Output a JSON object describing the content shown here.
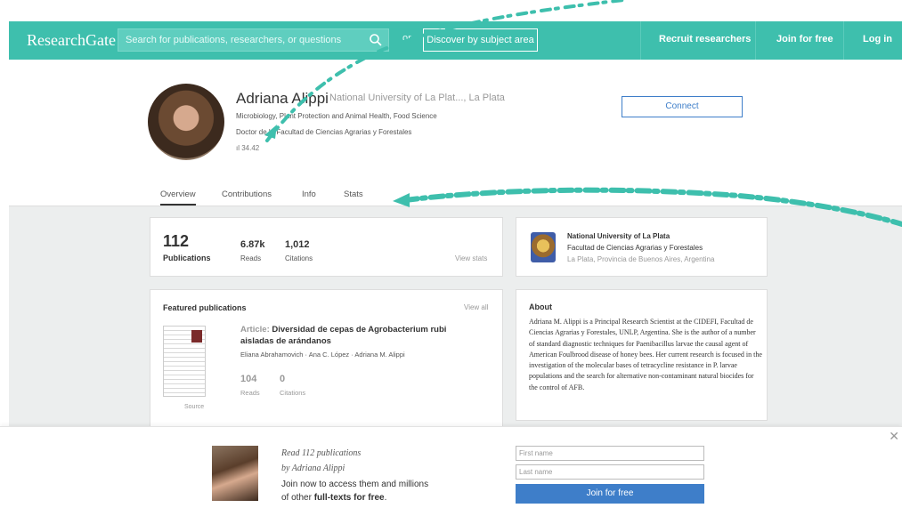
{
  "header": {
    "brand": "ResearchGate",
    "search_placeholder": "Search for publications, researchers, or questions",
    "or_text": "or",
    "discover_label": "Discover by subject area",
    "recruit_label": "Recruit researchers",
    "join_label": "Join for free",
    "login_label": "Log in"
  },
  "profile": {
    "name": "Adriana Alippi",
    "institution": "National University of La Plat..., La Plata",
    "disciplines": "Microbiology, Plant Protection and Animal Health, Food Science",
    "degree": "Doctor de la Facultad de Ciencias Agrarias y Forestales",
    "score": "34.42",
    "connect_label": "Connect"
  },
  "tabs": [
    {
      "label": "Overview"
    },
    {
      "label": "Contributions"
    },
    {
      "label": "Info"
    },
    {
      "label": "Stats"
    }
  ],
  "stats": {
    "publications_count": "112",
    "publications_label": "Publications",
    "reads_count": "6.87k",
    "reads_label": "Reads",
    "citations_count": "1,012",
    "citations_label": "Citations",
    "view_stats": "View stats"
  },
  "affiliation": {
    "university": "National University of La Plata",
    "faculty": "Facultad de Ciencias Agrarias y Forestales",
    "location": "La Plata, Provincia de Buenos Aires, Argentina"
  },
  "featured": {
    "title": "Featured publications",
    "view_all": "View all",
    "type": "Article:",
    "pub_title": "Diversidad de cepas de Agrobacterium rubi aisladas de arándanos",
    "authors": "Eliana Abrahamovich · Ana C. López · Adriana M. Alippi",
    "reads": "104",
    "reads_label": "Reads",
    "citations": "0",
    "citations_label": "Citations",
    "source": "Source"
  },
  "about": {
    "title": "About",
    "text": "Adriana M. Alippi is a Principal Research Scientist at the CIDEFI, Facultad de Ciencias Agrarias y Forestales, UNLP, Argentina. She is the author of a number of standard diagnostic techniques for Paenibacillus larvae the causal agent of American Foulbrood disease of honey bees. Her current research is focused in the investigation of the molecular bases of tetracycline resistance in P. larvae populations and the search for alternative non-contaminant natural biocides for the control of AFB."
  },
  "signup": {
    "line1": "Read 112 publications",
    "line2": "by Adriana Alippi",
    "line3": "Join now to access them and millions",
    "line4_prefix": "of other ",
    "line4_bold": "full-texts for free",
    "line4_suffix": ".",
    "first_name_placeholder": "First name",
    "last_name_placeholder": "Last name",
    "join_label": "Join for free"
  },
  "colors": {
    "brand": "#3ebfad",
    "link_blue": "#3e7ec9"
  }
}
